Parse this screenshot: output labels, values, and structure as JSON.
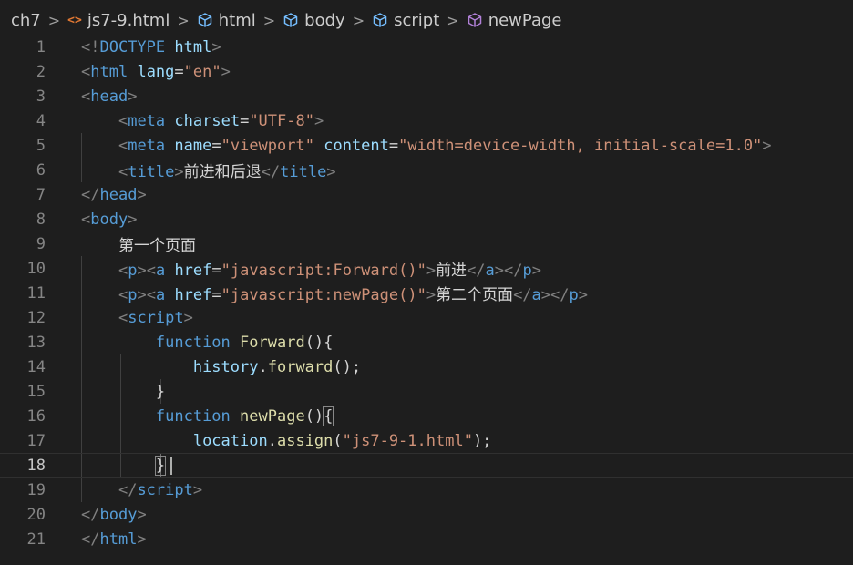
{
  "breadcrumb": {
    "items": [
      {
        "label": "ch7",
        "icon": "none"
      },
      {
        "label": "js7-9.html",
        "icon": "html-file-icon"
      },
      {
        "label": "html",
        "icon": "cube-icon"
      },
      {
        "label": "body",
        "icon": "cube-icon"
      },
      {
        "label": "script",
        "icon": "cube-icon"
      },
      {
        "label": "newPage",
        "icon": "method-icon"
      }
    ],
    "separator": ">"
  },
  "editor": {
    "current_line": 18,
    "lines": [
      {
        "n": "1",
        "tokens": [
          {
            "t": "<!",
            "c": "br"
          },
          {
            "t": "DOCTYPE",
            "c": "tag"
          },
          {
            "t": " ",
            "c": "txt"
          },
          {
            "t": "html",
            "c": "attr"
          },
          {
            "t": ">",
            "c": "br"
          }
        ]
      },
      {
        "n": "2",
        "tokens": [
          {
            "t": "<",
            "c": "br"
          },
          {
            "t": "html",
            "c": "tag"
          },
          {
            "t": " ",
            "c": "txt"
          },
          {
            "t": "lang",
            "c": "attr"
          },
          {
            "t": "=",
            "c": "pun"
          },
          {
            "t": "\"en\"",
            "c": "str"
          },
          {
            "t": ">",
            "c": "br"
          }
        ]
      },
      {
        "n": "3",
        "tokens": [
          {
            "t": "<",
            "c": "br"
          },
          {
            "t": "head",
            "c": "tag"
          },
          {
            "t": ">",
            "c": "br"
          }
        ]
      },
      {
        "n": "4",
        "tokens": [
          {
            "t": "    ",
            "c": "txt"
          },
          {
            "t": "<",
            "c": "br"
          },
          {
            "t": "meta",
            "c": "tag"
          },
          {
            "t": " ",
            "c": "txt"
          },
          {
            "t": "charset",
            "c": "attr"
          },
          {
            "t": "=",
            "c": "pun"
          },
          {
            "t": "\"UTF-8\"",
            "c": "str"
          },
          {
            "t": ">",
            "c": "br"
          }
        ]
      },
      {
        "n": "5",
        "tokens": [
          {
            "t": "    ",
            "c": "txt"
          },
          {
            "t": "<",
            "c": "br"
          },
          {
            "t": "meta",
            "c": "tag"
          },
          {
            "t": " ",
            "c": "txt"
          },
          {
            "t": "name",
            "c": "attr"
          },
          {
            "t": "=",
            "c": "pun"
          },
          {
            "t": "\"viewport\"",
            "c": "str"
          },
          {
            "t": " ",
            "c": "txt"
          },
          {
            "t": "content",
            "c": "attr"
          },
          {
            "t": "=",
            "c": "pun"
          },
          {
            "t": "\"width=device-width, initial-scale=1.0\"",
            "c": "str"
          },
          {
            "t": ">",
            "c": "br"
          }
        ]
      },
      {
        "n": "6",
        "tokens": [
          {
            "t": "    ",
            "c": "txt"
          },
          {
            "t": "<",
            "c": "br"
          },
          {
            "t": "title",
            "c": "tag"
          },
          {
            "t": ">",
            "c": "br"
          },
          {
            "t": "前进和后退",
            "c": "txt"
          },
          {
            "t": "</",
            "c": "br"
          },
          {
            "t": "title",
            "c": "tag"
          },
          {
            "t": ">",
            "c": "br"
          }
        ]
      },
      {
        "n": "7",
        "tokens": [
          {
            "t": "</",
            "c": "br"
          },
          {
            "t": "head",
            "c": "tag"
          },
          {
            "t": ">",
            "c": "br"
          }
        ]
      },
      {
        "n": "8",
        "tokens": [
          {
            "t": "<",
            "c": "br"
          },
          {
            "t": "body",
            "c": "tag"
          },
          {
            "t": ">",
            "c": "br"
          }
        ]
      },
      {
        "n": "9",
        "tokens": [
          {
            "t": "    ",
            "c": "txt"
          },
          {
            "t": "第一个页面",
            "c": "txt"
          }
        ]
      },
      {
        "n": "10",
        "tokens": [
          {
            "t": "    ",
            "c": "txt"
          },
          {
            "t": "<",
            "c": "br"
          },
          {
            "t": "p",
            "c": "tag"
          },
          {
            "t": "><",
            "c": "br"
          },
          {
            "t": "a",
            "c": "tag"
          },
          {
            "t": " ",
            "c": "txt"
          },
          {
            "t": "href",
            "c": "attr"
          },
          {
            "t": "=",
            "c": "pun"
          },
          {
            "t": "\"javascript:Forward()\"",
            "c": "str"
          },
          {
            "t": ">",
            "c": "br"
          },
          {
            "t": "前进",
            "c": "txt"
          },
          {
            "t": "</",
            "c": "br"
          },
          {
            "t": "a",
            "c": "tag"
          },
          {
            "t": "></",
            "c": "br"
          },
          {
            "t": "p",
            "c": "tag"
          },
          {
            "t": ">",
            "c": "br"
          }
        ]
      },
      {
        "n": "11",
        "tokens": [
          {
            "t": "    ",
            "c": "txt"
          },
          {
            "t": "<",
            "c": "br"
          },
          {
            "t": "p",
            "c": "tag"
          },
          {
            "t": "><",
            "c": "br"
          },
          {
            "t": "a",
            "c": "tag"
          },
          {
            "t": " ",
            "c": "txt"
          },
          {
            "t": "href",
            "c": "attr"
          },
          {
            "t": "=",
            "c": "pun"
          },
          {
            "t": "\"javascript:newPage()\"",
            "c": "str"
          },
          {
            "t": ">",
            "c": "br"
          },
          {
            "t": "第二个页面",
            "c": "txt"
          },
          {
            "t": "</",
            "c": "br"
          },
          {
            "t": "a",
            "c": "tag"
          },
          {
            "t": "></",
            "c": "br"
          },
          {
            "t": "p",
            "c": "tag"
          },
          {
            "t": ">",
            "c": "br"
          }
        ]
      },
      {
        "n": "12",
        "tokens": [
          {
            "t": "    ",
            "c": "txt"
          },
          {
            "t": "<",
            "c": "br"
          },
          {
            "t": "script",
            "c": "tag"
          },
          {
            "t": ">",
            "c": "br"
          }
        ]
      },
      {
        "n": "13",
        "tokens": [
          {
            "t": "        ",
            "c": "txt"
          },
          {
            "t": "function",
            "c": "kw"
          },
          {
            "t": " ",
            "c": "txt"
          },
          {
            "t": "Forward",
            "c": "fn"
          },
          {
            "t": "(){",
            "c": "pun"
          }
        ]
      },
      {
        "n": "14",
        "tokens": [
          {
            "t": "            ",
            "c": "txt"
          },
          {
            "t": "history",
            "c": "var"
          },
          {
            "t": ".",
            "c": "pun"
          },
          {
            "t": "forward",
            "c": "fn"
          },
          {
            "t": "();",
            "c": "pun"
          }
        ]
      },
      {
        "n": "15",
        "tokens": [
          {
            "t": "        ",
            "c": "txt"
          },
          {
            "t": "}",
            "c": "pun"
          }
        ]
      },
      {
        "n": "16",
        "tokens": [
          {
            "t": "        ",
            "c": "txt"
          },
          {
            "t": "function",
            "c": "kw"
          },
          {
            "t": " ",
            "c": "txt"
          },
          {
            "t": "newPage",
            "c": "fn"
          },
          {
            "t": "()",
            "c": "pun"
          },
          {
            "t": "{",
            "c": "pun",
            "hl": true
          }
        ]
      },
      {
        "n": "17",
        "tokens": [
          {
            "t": "            ",
            "c": "txt"
          },
          {
            "t": "location",
            "c": "var"
          },
          {
            "t": ".",
            "c": "pun"
          },
          {
            "t": "assign",
            "c": "fn"
          },
          {
            "t": "(",
            "c": "pun"
          },
          {
            "t": "\"js7-9-1.html\"",
            "c": "str"
          },
          {
            "t": ");",
            "c": "pun"
          }
        ]
      },
      {
        "n": "18",
        "tokens": [
          {
            "t": "        ",
            "c": "txt"
          },
          {
            "t": "}",
            "c": "pun",
            "hl": true
          }
        ]
      },
      {
        "n": "19",
        "tokens": [
          {
            "t": "    ",
            "c": "txt"
          },
          {
            "t": "</",
            "c": "br"
          },
          {
            "t": "script",
            "c": "tag"
          },
          {
            "t": ">",
            "c": "br"
          }
        ]
      },
      {
        "n": "20",
        "tokens": [
          {
            "t": "</",
            "c": "br"
          },
          {
            "t": "body",
            "c": "tag"
          },
          {
            "t": ">",
            "c": "br"
          }
        ]
      },
      {
        "n": "21",
        "tokens": [
          {
            "t": "</",
            "c": "br"
          },
          {
            "t": "html",
            "c": "tag"
          },
          {
            "t": ">",
            "c": "br"
          }
        ]
      }
    ]
  }
}
